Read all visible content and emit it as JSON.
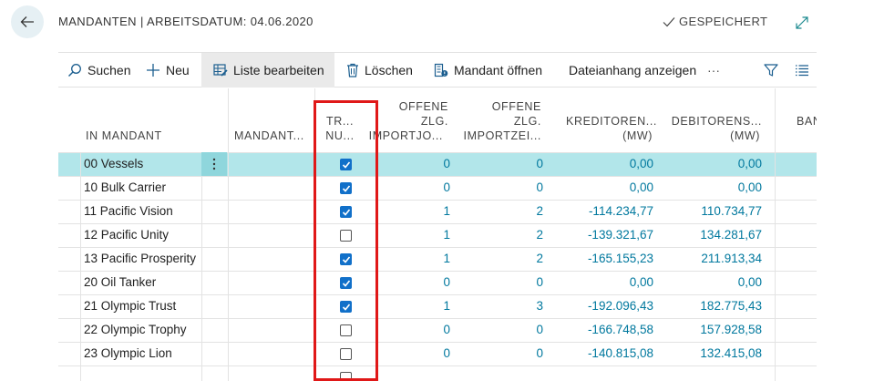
{
  "header": {
    "title": "MANDANTEN | ARBEITSDATUM: 04.06.2020",
    "saved_status": "GESPEICHERT"
  },
  "actions": {
    "search": "Suchen",
    "new": "Neu",
    "edit_list": "Liste bearbeiten",
    "delete": "Löschen",
    "open_company": "Mandant öffnen",
    "attachments": "Dateianhang anzeigen",
    "more": "···"
  },
  "columns": {
    "in_mandant": "IN MANDANT",
    "mandant": "MANDANT...",
    "tr_l1": "TR...",
    "tr_l2": "NU...",
    "oz1_l1": "OFFENE",
    "oz1_l2": "ZLG.",
    "oz1_l3": "IMPORTJO...",
    "oz2_l1": "OFFENE",
    "oz2_l2": "ZLG.",
    "oz2_l3": "IMPORTZEI...",
    "kred_l1": "KREDITOREN...",
    "kred_l2": "(MW)",
    "deb_l1": "DEBITORENS...",
    "deb_l2": "(MW)",
    "ban": "BAN"
  },
  "rows": [
    {
      "name": "00 Vessels",
      "checked": true,
      "oz1": "0",
      "oz2": "0",
      "kred": "0,00",
      "deb": "0,00"
    },
    {
      "name": "10 Bulk Carrier",
      "checked": true,
      "oz1": "0",
      "oz2": "0",
      "kred": "0,00",
      "deb": "0,00"
    },
    {
      "name": "11 Pacific Vision",
      "checked": true,
      "oz1": "1",
      "oz2": "2",
      "kred": "-114.234,77",
      "deb": "110.734,77"
    },
    {
      "name": "12 Pacific Unity",
      "checked": false,
      "oz1": "1",
      "oz2": "2",
      "kred": "-139.321,67",
      "deb": "134.281,67"
    },
    {
      "name": "13 Pacific Prosperity",
      "checked": true,
      "oz1": "1",
      "oz2": "2",
      "kred": "-165.155,23",
      "deb": "211.913,34"
    },
    {
      "name": "20 Oil Tanker",
      "checked": true,
      "oz1": "0",
      "oz2": "0",
      "kred": "0,00",
      "deb": "0,00"
    },
    {
      "name": "21 Olympic Trust",
      "checked": true,
      "oz1": "1",
      "oz2": "3",
      "kred": "-192.096,43",
      "deb": "182.775,43"
    },
    {
      "name": "22 Olympic Trophy",
      "checked": false,
      "oz1": "0",
      "oz2": "0",
      "kred": "-166.748,58",
      "deb": "157.928,58"
    },
    {
      "name": "23 Olympic Lion",
      "checked": false,
      "oz1": "0",
      "oz2": "0",
      "kred": "-140.815,08",
      "deb": "132.415,08"
    },
    {
      "name": "",
      "checked": false,
      "oz1": "",
      "oz2": "",
      "kred": "",
      "deb": ""
    }
  ],
  "colors": {
    "accent": "#00789e",
    "selected_row": "#b2e6ea",
    "checkbox": "#1170c9",
    "highlight": "#e01818"
  }
}
